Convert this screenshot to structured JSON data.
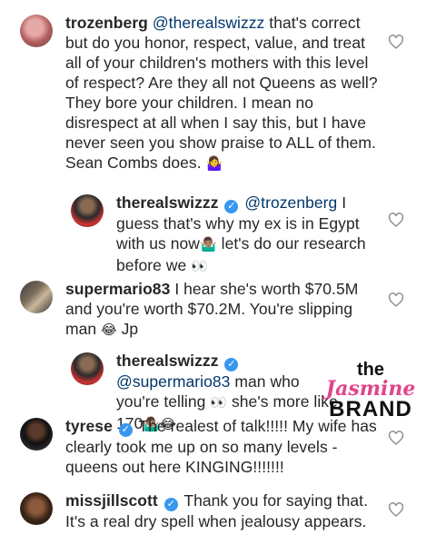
{
  "comments": [
    {
      "username": "trozenberg",
      "verified": false,
      "mention": "@therealswizzz",
      "text": "that's correct but do you honor, respect, value, and treat all of your children's mothers with this level of respect? Are they all not Queens as well? They bore your children. I mean no disrespect at all when I say this, but I have never seen you show praise to ALL of them. Sean Combs does. ",
      "emoji": "🤷‍♀️",
      "avatar_icon": "user-avatar-icon",
      "heart_icon": "heart-outline-icon"
    },
    {
      "username": "therealswizzz",
      "verified": true,
      "mention": "@trozenberg",
      "text": "I guess that's why my ex is in Egypt with us now",
      "emoji": "🤷🏽‍♂️",
      "text2": " let's do our research before we ",
      "emoji2": "👀",
      "avatar_icon": "user-avatar-icon",
      "heart_icon": "heart-outline-icon"
    },
    {
      "username": "supermario83",
      "verified": false,
      "text": "I hear she's worth $70.5M and you're worth $70.2M. You're slipping man ",
      "emoji": "😂",
      "text2": " Jp",
      "avatar_icon": "user-avatar-icon",
      "heart_icon": "heart-outline-icon"
    },
    {
      "username": "therealswizzz",
      "verified": true,
      "mention": "@supermario83",
      "text": "man who you're telling ",
      "emoji": "👀",
      "text2": " she's more like 170",
      "emoji2": "🤷🏽‍♂️😂",
      "avatar_icon": "user-avatar-icon",
      "heart_icon": "heart-outline-icon"
    },
    {
      "username": "tyrese",
      "verified": true,
      "text": "The realest of talk!!!!! My wife has clearly took me up on so many levels - queens out here KINGING!!!!!!!",
      "avatar_icon": "user-avatar-icon",
      "heart_icon": "heart-outline-icon"
    },
    {
      "username": "missjillscott",
      "verified": true,
      "text": "Thank you for saying that. It's a real dry spell when jealousy appears.",
      "avatar_icon": "user-avatar-icon",
      "heart_icon": "heart-outline-icon"
    }
  ],
  "verified_badge": "✓",
  "watermark": {
    "line1": "the",
    "line2": "Jasmine",
    "line3": "BRAND"
  },
  "colors": {
    "text": "#262626",
    "mention": "#00376b",
    "verified": "#3897f0",
    "watermark_pink": "#e0458a"
  }
}
